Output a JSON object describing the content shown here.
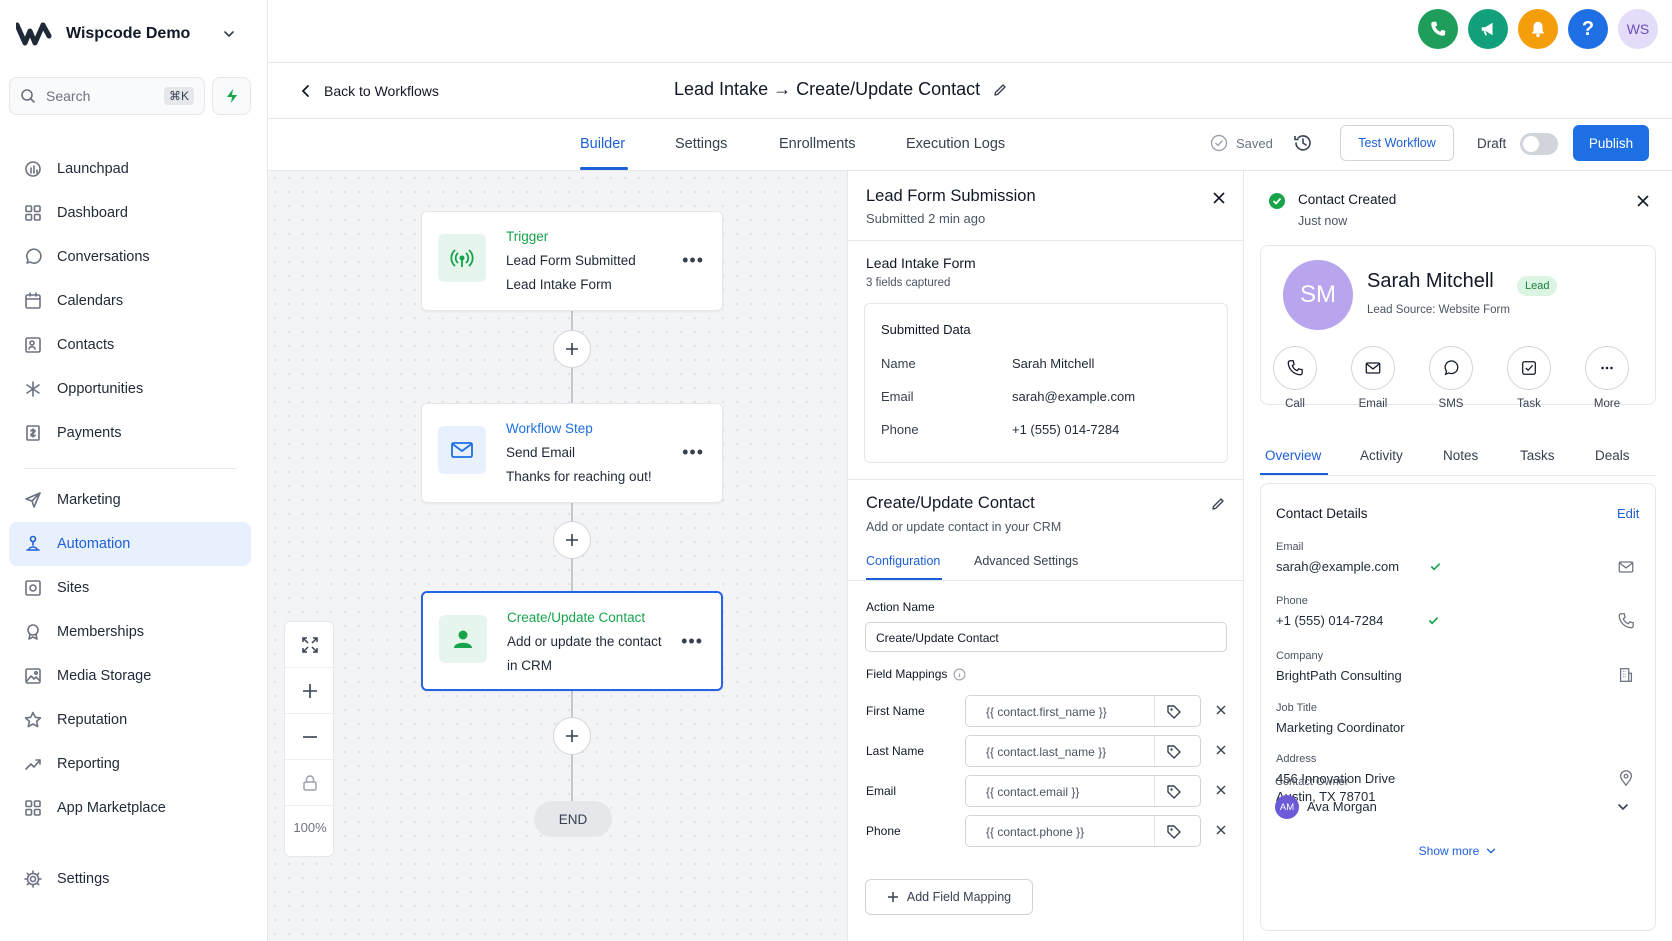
{
  "sidebar": {
    "account_name": "Wispcode Demo",
    "search_placeholder": "Search",
    "search_shortcut": "⌘K",
    "items": [
      {
        "label": "Launchpad",
        "icon": "launchpad-icon"
      },
      {
        "label": "Dashboard",
        "icon": "grid-icon"
      },
      {
        "label": "Conversations",
        "icon": "chat-icon"
      },
      {
        "label": "Calendars",
        "icon": "calendar-icon"
      },
      {
        "label": "Contacts",
        "icon": "contact-card-icon"
      },
      {
        "label": "Opportunities",
        "icon": "asterisk-icon"
      },
      {
        "label": "Payments",
        "icon": "receipt-icon"
      },
      {
        "label": "Marketing",
        "icon": "send-icon"
      },
      {
        "label": "Automation",
        "icon": "automation-icon",
        "active": true
      },
      {
        "label": "Sites",
        "icon": "globe-icon"
      },
      {
        "label": "Memberships",
        "icon": "badge-icon"
      },
      {
        "label": "Media Storage",
        "icon": "image-icon"
      },
      {
        "label": "Reputation",
        "icon": "star-icon"
      },
      {
        "label": "Reporting",
        "icon": "trend-icon"
      },
      {
        "label": "App Marketplace",
        "icon": "apps-icon"
      },
      {
        "label": "Settings",
        "icon": "gear-icon"
      }
    ]
  },
  "topbar": {
    "user_initials": "WS",
    "colors": {
      "phone": "#1e9e5a",
      "megaphone": "#12a07a",
      "bell": "#f59e0b",
      "help": "#1d6fe3"
    }
  },
  "header": {
    "back_label": "Back to Workflows",
    "workflow_title": "Lead Intake → Create/Update Contact"
  },
  "tabs": {
    "items": [
      "Builder",
      "Settings",
      "Enrollments",
      "Execution Logs"
    ],
    "active": "Builder",
    "saved_label": "Saved",
    "test_label": "Test Workflow",
    "draft_label": "Draft",
    "publish_label": "Publish"
  },
  "canvas": {
    "zoom": "100%",
    "end_label": "END",
    "nodes": [
      {
        "title": "Trigger",
        "line1": "Lead Form Submitted",
        "line2": "Lead Intake Form",
        "color": "#16a34a"
      },
      {
        "title": "Workflow Step",
        "line1": "Send Email",
        "line2": "Thanks for reaching out!",
        "color": "#1d6fe3"
      },
      {
        "title": "Create/Update Contact",
        "line1": "Add or update the contact",
        "line2": "in CRM",
        "color": "#16a34a"
      }
    ]
  },
  "form_panel": {
    "title": "Lead Form Submission",
    "subtitle": "Submitted 2 min ago",
    "form_name": "Lead Intake Form",
    "fields_captured": "3 fields captured",
    "submitted_title": "Submitted Data",
    "submitted": [
      {
        "key": "Name",
        "value": "Sarah Mitchell"
      },
      {
        "key": "Email",
        "value": "sarah@example.com"
      },
      {
        "key": "Phone",
        "value": "+1 (555) 014-7284"
      }
    ],
    "action_title": "Create/Update Contact",
    "action_subtitle": "Add or update contact in your CRM",
    "action_tabs": [
      "Configuration",
      "Advanced Settings"
    ],
    "action_name_label": "Action Name",
    "action_name_value": "Create/Update Contact",
    "field_mappings_label": "Field Mappings",
    "mappings": [
      {
        "key": "First Name",
        "value": "{{ contact.first_name }}"
      },
      {
        "key": "Last Name",
        "value": "{{ contact.last_name }}"
      },
      {
        "key": "Email",
        "value": "{{ contact.email }}"
      },
      {
        "key": "Phone",
        "value": "{{ contact.phone }}"
      }
    ],
    "add_mapping_label": "Add Field Mapping"
  },
  "contact_panel": {
    "title": "Contact Created",
    "subtitle": "Just now",
    "initials": "SM",
    "name": "Sarah Mitchell",
    "badge": "Lead",
    "lead_source": "Lead Source: Website Form",
    "actions": [
      "Call",
      "Email",
      "SMS",
      "Task",
      "More"
    ],
    "tabs": [
      "Overview",
      "Activity",
      "Notes",
      "Tasks",
      "Deals"
    ],
    "details_title": "Contact Details",
    "edit_label": "Edit",
    "details": {
      "email_label": "Email",
      "email": "sarah@example.com",
      "phone_label": "Phone",
      "phone": "+1 (555) 014-7284",
      "company_label": "Company",
      "company": "BrightPath Consulting",
      "job_label": "Job Title",
      "job": "Marketing Coordinator",
      "address_label": "Address",
      "address1": "456 Innovation Drive",
      "address2": "Austin, TX 78701",
      "owner_label": "Contact Owner",
      "owner_initials": "AM",
      "owner": "Ava Morgan"
    },
    "show_more": "Show more"
  }
}
